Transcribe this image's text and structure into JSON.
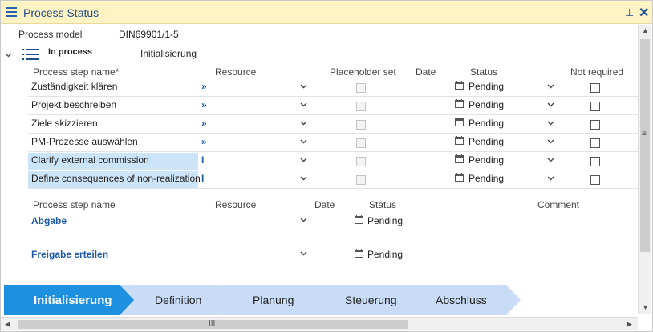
{
  "window": {
    "title": "Process Status"
  },
  "model": {
    "label": "Process model",
    "value": "DIN69901/1-5"
  },
  "group": {
    "label": "In process",
    "phase": "Initialisierung"
  },
  "table1": {
    "headers": {
      "name": "Process step name*",
      "resource": "Resource",
      "placeholder": "Placeholder set",
      "date": "Date",
      "status": "Status",
      "notreq": "Not required"
    },
    "rows": [
      {
        "name": "Zuständigkeit klären",
        "res": "»",
        "status": "Pending"
      },
      {
        "name": "Projekt beschreiben",
        "res": "»",
        "status": "Pending"
      },
      {
        "name": "Ziele skizzieren",
        "res": "»",
        "status": "Pending"
      },
      {
        "name": "PM-Prozesse auswählen",
        "res": "»",
        "status": "Pending"
      },
      {
        "name": "Clarify external commission",
        "res": "I",
        "status": "Pending"
      },
      {
        "name": "Define consequences of non-realization",
        "res": "I",
        "status": "Pending"
      }
    ]
  },
  "table2": {
    "headers": {
      "name": "Process step name",
      "resource": "Resource",
      "date": "Date",
      "status": "Status",
      "comment": "Comment"
    },
    "rows": [
      {
        "name": "Abgabe",
        "status": "Pending"
      },
      {
        "name": "Freigabe erteilen",
        "status": "Pending"
      }
    ]
  },
  "steps": [
    "Initialisierung",
    "Definition",
    "Planung",
    "Steuerung",
    "Abschluss"
  ],
  "colors": {
    "active": "#1e90e0",
    "inactive": "#c8dcf7",
    "title_bg": "#fff3c4",
    "accent": "#1f4e8c"
  }
}
